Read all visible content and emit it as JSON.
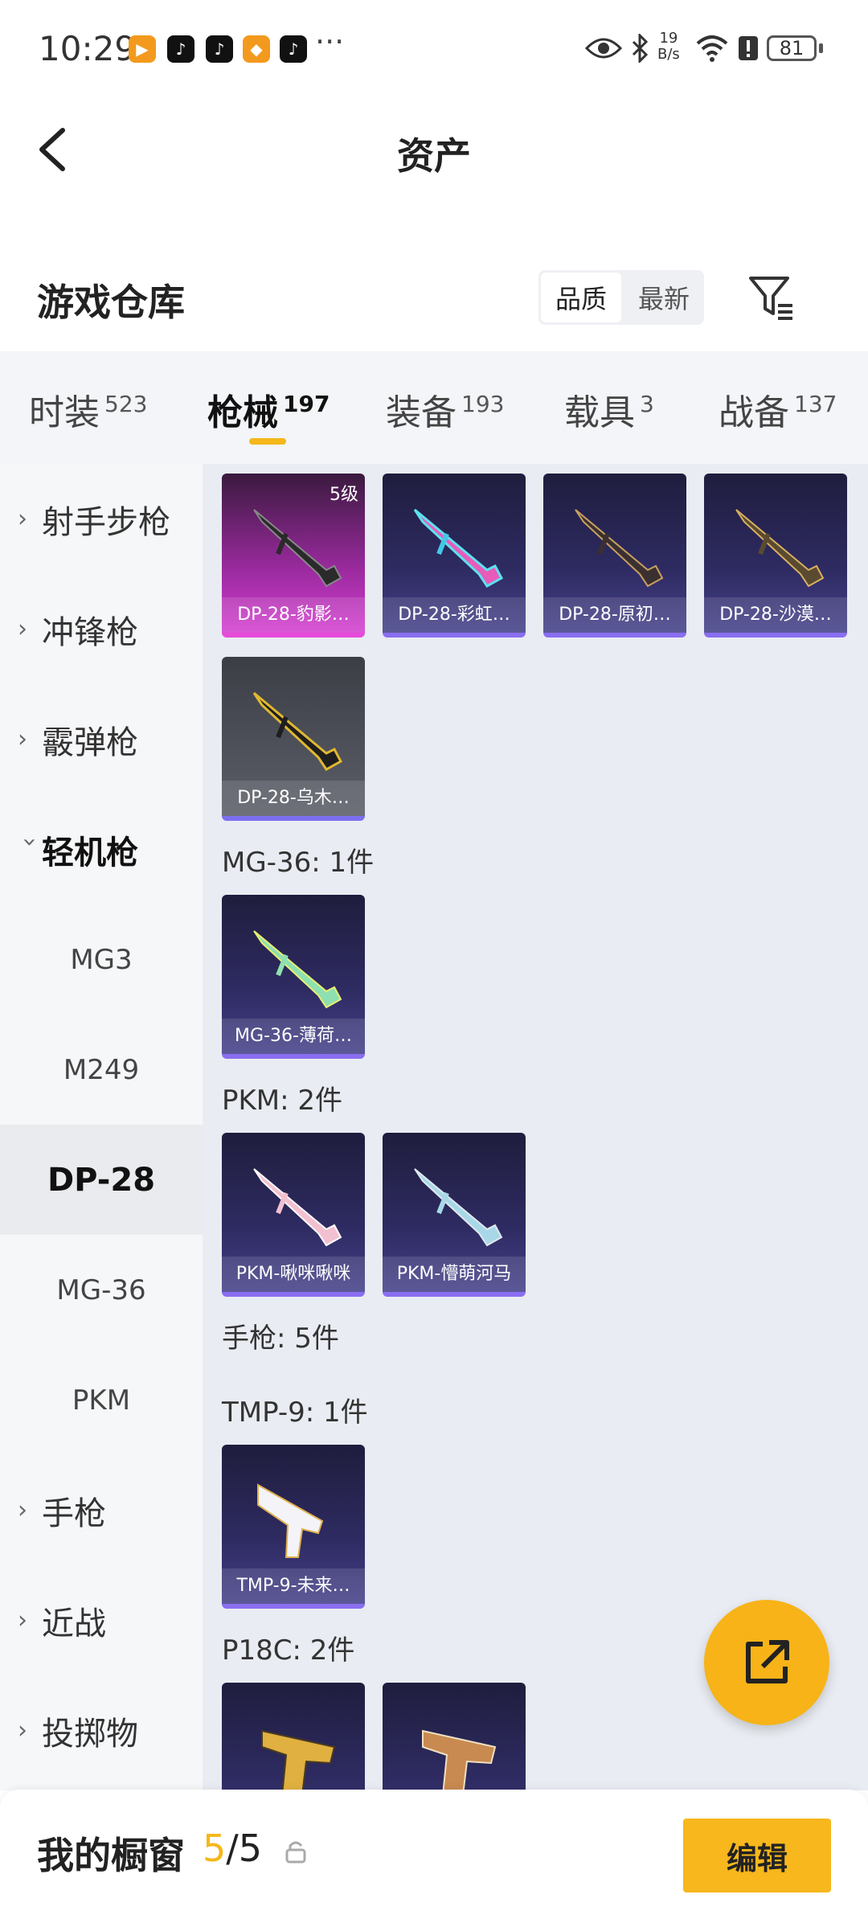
{
  "status_bar": {
    "time": "10:29",
    "speed_value": "19",
    "speed_unit": "B/s",
    "battery": "81"
  },
  "header": {
    "title": "资产"
  },
  "warehouse": {
    "title": "游戏仓库",
    "sort_options": [
      "品质",
      "最新"
    ],
    "sort_selected": "品质"
  },
  "tabs": [
    {
      "label": "时装",
      "count": "523"
    },
    {
      "label": "枪械",
      "count": "197",
      "active": true
    },
    {
      "label": "装备",
      "count": "193"
    },
    {
      "label": "载具",
      "count": "3"
    },
    {
      "label": "战备",
      "count": "137"
    }
  ],
  "sidebar": {
    "items": [
      {
        "label": "射手步枪",
        "type": "category"
      },
      {
        "label": "冲锋枪",
        "type": "category"
      },
      {
        "label": "霰弹枪",
        "type": "category"
      },
      {
        "label": "轻机枪",
        "type": "category",
        "expanded": true
      },
      {
        "label": "MG3",
        "type": "sub"
      },
      {
        "label": "M249",
        "type": "sub"
      },
      {
        "label": "DP-28",
        "type": "sub",
        "active": true
      },
      {
        "label": "MG-36",
        "type": "sub"
      },
      {
        "label": "PKM",
        "type": "sub"
      },
      {
        "label": "手枪",
        "type": "category"
      },
      {
        "label": "近战",
        "type": "category"
      },
      {
        "label": "投掷物",
        "type": "category"
      }
    ]
  },
  "content": {
    "cards": [
      {
        "name": "DP-28-豹影…",
        "grade": "5级",
        "style": "pink"
      },
      {
        "name": "DP-28-彩虹…",
        "style": "purple"
      },
      {
        "name": "DP-28-原初…",
        "style": "purple"
      },
      {
        "name": "DP-28-沙漠…",
        "style": "purple"
      },
      {
        "name": "DP-28-乌木…",
        "style": "grey"
      },
      {
        "name": "MG-36-薄荷…",
        "style": "purple"
      },
      {
        "name": "PKM-啾咪啾咪",
        "style": "purple"
      },
      {
        "name": "PKM-懵萌河马",
        "style": "purple"
      },
      {
        "name": "TMP-9-未来…",
        "style": "purple"
      },
      {
        "name": "",
        "style": "purple"
      },
      {
        "name": "",
        "style": "purple"
      }
    ],
    "group_labels": [
      "MG-36: 1件",
      "PKM: 2件",
      "手枪: 5件",
      "TMP-9: 1件",
      "P18C: 2件"
    ]
  },
  "bottom_bar": {
    "title": "我的橱窗",
    "count_current": "5",
    "count_separator": "/5",
    "edit_label": "编辑"
  },
  "colors": {
    "accent": "#f5b71a",
    "card_purple": "#2e2b62",
    "card_pink": "#d43fd0",
    "content_bg": "#e9ecf2"
  }
}
